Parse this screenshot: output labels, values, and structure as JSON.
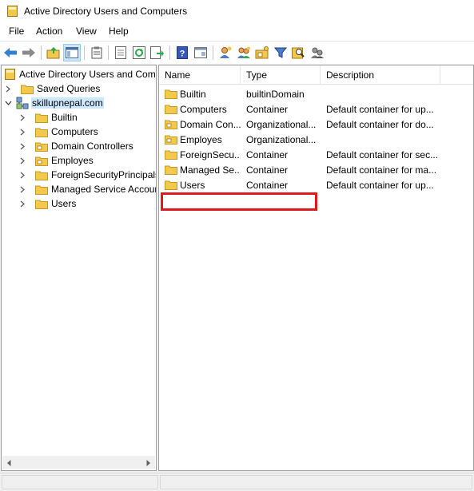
{
  "window": {
    "title": "Active Directory Users and Computers"
  },
  "menu": [
    "File",
    "Action",
    "View",
    "Help"
  ],
  "toolbar": [
    "back-arrow-icon",
    "forward-arrow-icon",
    "up-folder-icon",
    "show-console-tree-icon",
    "clipboard-icon",
    "properties-sheet-icon",
    "refresh-icon",
    "export-list-icon",
    "help-icon",
    "console-view-icon",
    "new-user-icon",
    "new-group-icon",
    "new-ou-icon",
    "filter-icon",
    "find-icon",
    "delegate-control-icon"
  ],
  "tree": {
    "root": "Active Directory Users and Com",
    "saved_queries": "Saved Queries",
    "domain": "skillupnepal.com",
    "children": [
      "Builtin",
      "Computers",
      "Domain Controllers",
      "Employes",
      "ForeignSecurityPrincipals",
      "Managed Service Accour",
      "Users"
    ]
  },
  "list": {
    "columns": [
      "Name",
      "Type",
      "Description"
    ],
    "rows": [
      {
        "name": "Builtin",
        "type": "builtinDomain",
        "desc": ""
      },
      {
        "name": "Computers",
        "type": "Container",
        "desc": "Default container for up..."
      },
      {
        "name": "Domain Con...",
        "type": "Organizational...",
        "desc": "Default container for do..."
      },
      {
        "name": "Employes",
        "type": "Organizational...",
        "desc": ""
      },
      {
        "name": "ForeignSecu...",
        "type": "Container",
        "desc": "Default container for sec..."
      },
      {
        "name": "Managed Se...",
        "type": "Container",
        "desc": "Default container for ma..."
      },
      {
        "name": "Users",
        "type": "Container",
        "desc": "Default container for up..."
      }
    ]
  },
  "colors": {
    "highlight": "#e0191f",
    "selection": "#cce8ff",
    "folder": "#f4c84a"
  }
}
